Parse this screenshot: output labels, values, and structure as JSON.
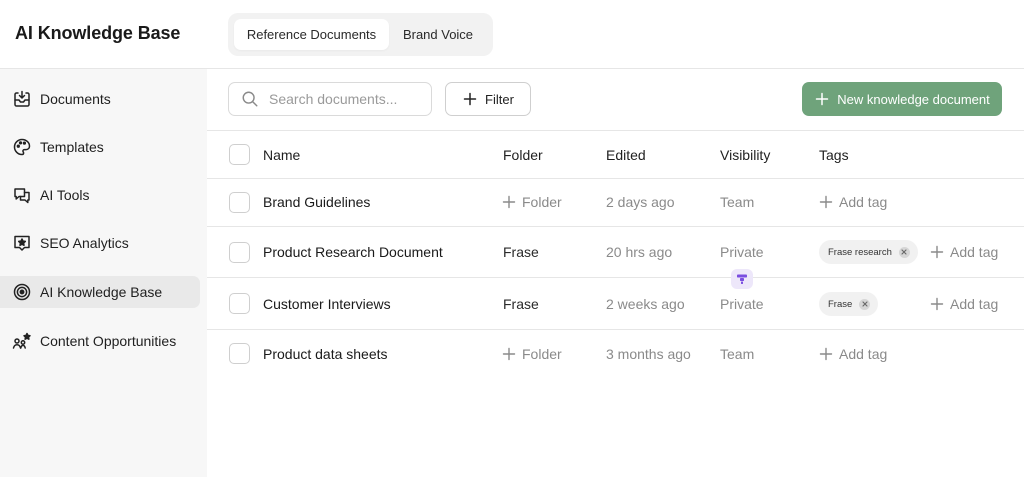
{
  "app": {
    "title": "AI Knowledge Base"
  },
  "tabs": [
    {
      "label": "Reference Documents",
      "active": true
    },
    {
      "label": "Brand Voice",
      "active": false
    }
  ],
  "sidebar": {
    "items": [
      {
        "label": "Documents",
        "icon": "document-inbox-icon"
      },
      {
        "label": "Templates",
        "icon": "palette-icon"
      },
      {
        "label": "AI Tools",
        "icon": "chat-bubbles-icon"
      },
      {
        "label": "SEO Analytics",
        "icon": "star-chat-icon"
      },
      {
        "label": "AI Knowledge Base",
        "icon": "target-icon",
        "active": true
      },
      {
        "label": "Content Opportunities",
        "icon": "people-star-icon"
      }
    ]
  },
  "toolbar": {
    "search_placeholder": "Search documents...",
    "filter_label": "Filter",
    "new_label": "New knowledge document"
  },
  "table": {
    "columns": [
      "Name",
      "Folder",
      "Edited",
      "Visibility",
      "Tags"
    ],
    "rows": [
      {
        "name": "Brand Guidelines",
        "folder": "Folder",
        "folder_is_add": true,
        "edited": "2 days ago",
        "visibility": "Team",
        "tags": [],
        "add_tag": "Add tag"
      },
      {
        "name": "Product Research Document",
        "folder": "Frase",
        "folder_is_add": false,
        "edited": "20 hrs ago",
        "visibility": "Private",
        "tags": [
          "Frase research"
        ],
        "add_tag": "Add tag"
      },
      {
        "name": "Customer Interviews",
        "folder": "Frase",
        "folder_is_add": false,
        "edited": "2 weeks ago",
        "visibility": "Private",
        "tags": [
          "Frase"
        ],
        "add_tag": "Add tag"
      },
      {
        "name": "Product data sheets",
        "folder": "Folder",
        "folder_is_add": true,
        "edited": "3 months ago",
        "visibility": "Team",
        "tags": [],
        "add_tag": "Add tag"
      }
    ]
  },
  "colors": {
    "accent_green": "#6fa37b",
    "sidebar_bg": "#f7f7f7",
    "active_nav_bg": "#e9e9e9",
    "badge_purple": "#7a4ee0"
  }
}
